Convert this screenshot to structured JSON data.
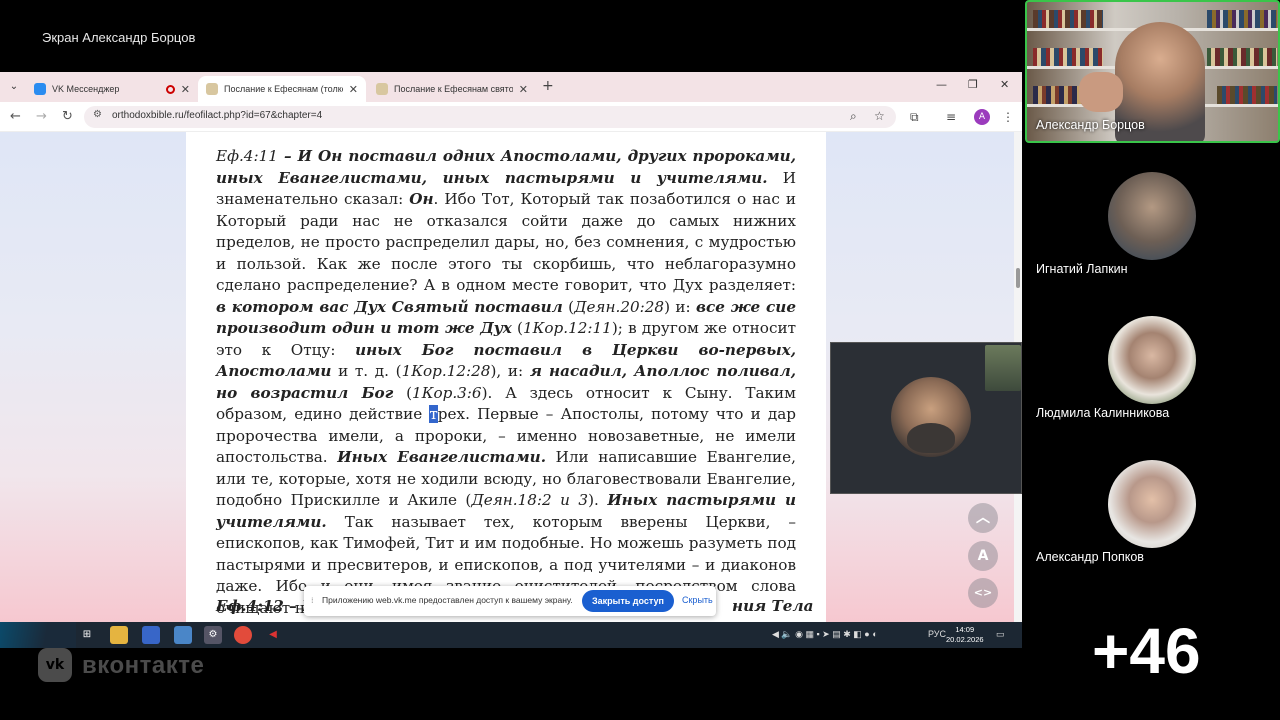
{
  "screen_title": "Экран Александр Борцов",
  "browser": {
    "tabs": [
      {
        "label": "VK Мессенджер",
        "active": false
      },
      {
        "label": "Послание к Ефесянам (толков",
        "active": true
      },
      {
        "label": "Послание к Ефесянам святого",
        "active": false
      }
    ],
    "url": "orthodoxbible.ru/feofilact.php?id=67&chapter=4",
    "profile_initial": "A"
  },
  "document": {
    "verse1_ref": "Еф.4:11",
    "verse1_quote": " – И Он поставил одних Апостолами, других пророками, иных Евангелистами, иных пастырями и учителями.",
    "p1": " И знаменательно сказал: ",
    "on": "Он",
    "p2": ". Ибо Тот, Который так позаботился о нас и Который ради нас не отказался сойти даже до самых нижних пределов, не просто распределил дары, но, без сомнения, с мудростью и пользой. Как же после этого ты скорбишь, что неблагоразумно сделано распределение? А в одном месте говорит, что Дух разделяет: ",
    "q1": "в котором вас Дух Святый поставил",
    "r1": "Деян.20:28",
    "p3": " и: ",
    "q2": "все же сие производит один и тот же Дух",
    "r2": "1Кор.12:11",
    "p4": "; в другом же относит это к Отцу: ",
    "q3": "иных Бог поставил в Церкви во-первых, Апостолами",
    "p5": " и т. д. ",
    "r3": "1Кор.12:28",
    "p6": ", и: ",
    "q4": "я насадил, Аполлос поливал, но возрастил Бог",
    "r4": "1Кор.3:6",
    "p7": ". А здесь относит к Сыну. Таким образом, едино действие ",
    "hl": "т",
    "p8": "рех. Первые – Апостолы, потому что и дар пророчества имели, а пророки, – именно новозаветные, не имели апостольства. ",
    "q5": "Иных Евангелистами.",
    "p9": " Или написавшие Евангелие, или те, которые, хотя не ходили всюду, но благовествовали Евангелие, подобно Прискилле и Акиле ",
    "r5": "Деян.18:2 и 3",
    "p10": ". ",
    "q6": "Иных пастырями и учителями.",
    "p11": " Так называет тех, которым вверены Церкви, – епископов, как Тимофей, Тит и им подобные. Но можешь разуметь под пастырями и пресвитеров, и епископов, а под учителями – и диаконов даже. Ибо и они, имея звание очистителей, посредством слова очищают народ.",
    "verse2_start": "Еф.4:12 – К",
    "verse2_end": "ния Тела"
  },
  "share_notice": {
    "message": "Приложению web.vk.me предоставлен доступ к вашему экрану.",
    "close_button": "Закрыть доступ",
    "hide_link": "Скрыть"
  },
  "taskbar": {
    "lang": "РУС",
    "time": "14:09",
    "date": "20.02.2026"
  },
  "side_buttons": {
    "text_size": "A"
  },
  "brand": "вконтакте",
  "brand_mark": "vk",
  "participants": [
    {
      "name": "Александр Борцов"
    },
    {
      "name": "Игнатий Лапкин"
    },
    {
      "name": "Людмила Калинникова"
    },
    {
      "name": "Александр Попков"
    }
  ],
  "more_count": "+46",
  "colors": {
    "active_speaker": "#3ac54a",
    "share_button": "#1a5fd0",
    "profile": "#9b3bbd"
  }
}
